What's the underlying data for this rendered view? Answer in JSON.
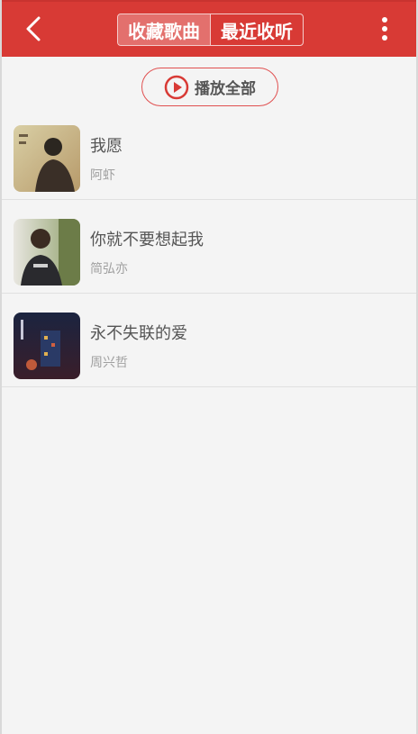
{
  "header": {
    "tabs": [
      {
        "label": "收藏歌曲",
        "active": true
      },
      {
        "label": "最近收听",
        "active": false
      }
    ],
    "back_icon": "chevron-left-icon",
    "more_icon": "vertical-dots-icon",
    "background_color": "#d83a35"
  },
  "play_all": {
    "label": "播放全部",
    "icon": "play-circle-icon",
    "accent_color": "#d83a35"
  },
  "songs": [
    {
      "title": "我愿",
      "artist": "阿虾"
    },
    {
      "title": "你就不要想起我",
      "artist": "简弘亦"
    },
    {
      "title": "永不失联的爱",
      "artist": "周兴哲"
    }
  ]
}
